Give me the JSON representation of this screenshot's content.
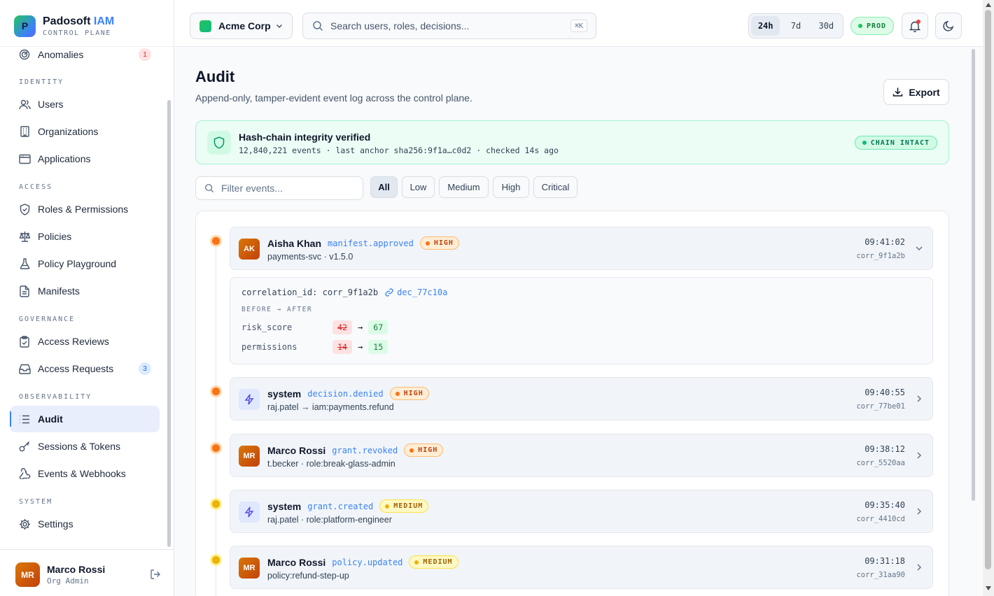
{
  "brand": {
    "name": "Padosoft",
    "name_accent": "IAM",
    "subtitle": "CONTROL PLANE",
    "logo_letter": "P"
  },
  "sidebar": {
    "anomalies": {
      "label": "Anomalies",
      "badge": "1"
    },
    "sections": {
      "identity": "IDENTITY",
      "access": "ACCESS",
      "governance": "GOVERNANCE",
      "observability": "OBSERVABILITY",
      "system": "SYSTEM"
    },
    "items": {
      "users": "Users",
      "organizations": "Organizations",
      "applications": "Applications",
      "roles": "Roles & Permissions",
      "policies": "Policies",
      "playground": "Policy Playground",
      "manifests": "Manifests",
      "access_reviews": "Access Reviews",
      "access_requests": "Access Requests",
      "access_requests_badge": "3",
      "audit": "Audit",
      "sessions": "Sessions & Tokens",
      "events": "Events & Webhooks",
      "settings": "Settings"
    },
    "user": {
      "initials": "MR",
      "name": "Marco Rossi",
      "role": "Org Admin"
    }
  },
  "topbar": {
    "org": "Acme Corp",
    "search_placeholder": "Search users, roles, decisions...",
    "search_shortcut": "⌘K",
    "ranges": [
      "24h",
      "7d",
      "30d"
    ],
    "active_range": "24h",
    "env": "PROD"
  },
  "page": {
    "title": "Audit",
    "subtitle": "Append-only, tamper-evident event log across the control plane.",
    "export_label": "Export"
  },
  "integrity": {
    "title": "Hash-chain integrity verified",
    "meta": "12,840,221 events · last anchor sha256:9f1a…c0d2 · checked 14s ago",
    "status": "CHAIN INTACT"
  },
  "filters": {
    "placeholder": "Filter events...",
    "severities": [
      "All",
      "Low",
      "Medium",
      "High",
      "Critical"
    ],
    "active": "All"
  },
  "events": [
    {
      "actor": "Aisha Khan",
      "initials": "AK",
      "action": "manifest.approved",
      "severity": "HIGH",
      "target": "payments-svc · v1.5.0",
      "time": "09:41:02",
      "corr": "corr_9f1a2b",
      "expanded": true
    },
    {
      "actor": "system",
      "initials": "",
      "action": "decision.denied",
      "severity": "HIGH",
      "target": "raj.patel → iam:payments.refund",
      "time": "09:40:55",
      "corr": "corr_77be01",
      "expanded": false
    },
    {
      "actor": "Marco Rossi",
      "initials": "MR",
      "action": "grant.revoked",
      "severity": "HIGH",
      "target": "t.becker · role:break-glass-admin",
      "time": "09:38:12",
      "corr": "corr_5520aa",
      "expanded": false
    },
    {
      "actor": "system",
      "initials": "",
      "action": "grant.created",
      "severity": "MEDIUM",
      "target": "raj.patel · role:platform-engineer",
      "time": "09:35:40",
      "corr": "corr_4410cd",
      "expanded": false
    },
    {
      "actor": "Marco Rossi",
      "initials": "MR",
      "action": "policy.updated",
      "severity": "MEDIUM",
      "target": "policy:refund-step-up",
      "time": "09:31:18",
      "corr": "corr_31aa90",
      "expanded": false
    }
  ],
  "detail": {
    "correlation": "correlation_id: corr_9f1a2b",
    "decision_link": "dec_77c10a",
    "diff_heading": "BEFORE → AFTER",
    "diff": [
      {
        "key": "risk_score",
        "before": "42",
        "after": "67"
      },
      {
        "key": "permissions",
        "before": "14",
        "after": "15"
      }
    ],
    "arrow": "→"
  },
  "colors": {
    "accent": "#3b82f6",
    "high": "#f97316",
    "medium": "#eab308",
    "success": "#059669"
  }
}
